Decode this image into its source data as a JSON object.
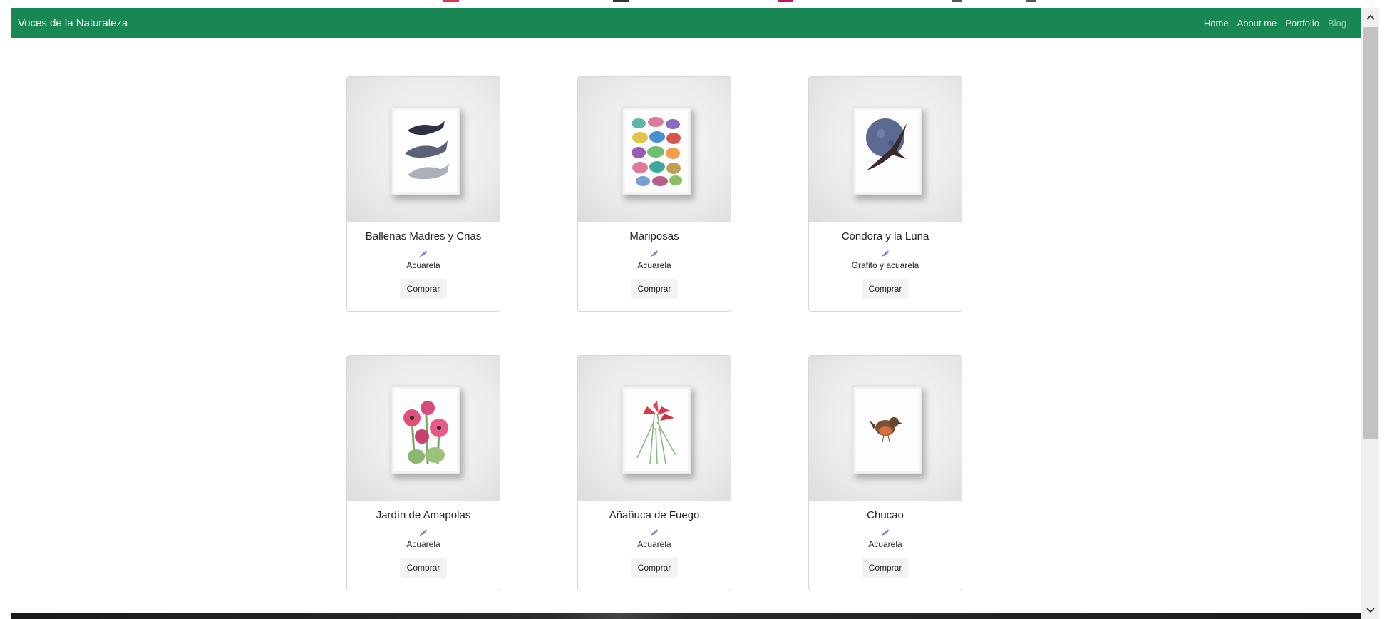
{
  "navbar": {
    "brand": "Voces de la Naturaleza",
    "links": [
      {
        "label": "Home"
      },
      {
        "label": "About me"
      },
      {
        "label": "Portfolio"
      },
      {
        "label": "Blog"
      }
    ],
    "color": "#198754"
  },
  "cards": [
    {
      "title": "Ballenas Madres y Crias",
      "technique": "Acuarela",
      "button": "Comprar",
      "art": "whales-art"
    },
    {
      "title": "Mariposas",
      "technique": "Acuarela",
      "button": "Comprar",
      "art": "butterflies-art"
    },
    {
      "title": "Cóndora y la Luna",
      "technique": "Grafito y acuarela",
      "button": "Comprar",
      "art": "condor-moon-art"
    },
    {
      "title": "Jardín de Amapolas",
      "technique": "Acuarela",
      "button": "Comprar",
      "art": "poppies-art"
    },
    {
      "title": "Añañuca de Fuego",
      "technique": "Acuarela",
      "button": "Comprar",
      "art": "red-lily-art"
    },
    {
      "title": "Chucao",
      "technique": "Acuarela",
      "button": "Comprar",
      "art": "chucao-bird-art"
    }
  ],
  "icons": {
    "feather": "feather-icon",
    "scroll_up": "chevron-up-icon",
    "scroll_down": "chevron-down-icon"
  },
  "colors": {
    "feather": "#9b7fd0",
    "navbar": "#198754"
  }
}
